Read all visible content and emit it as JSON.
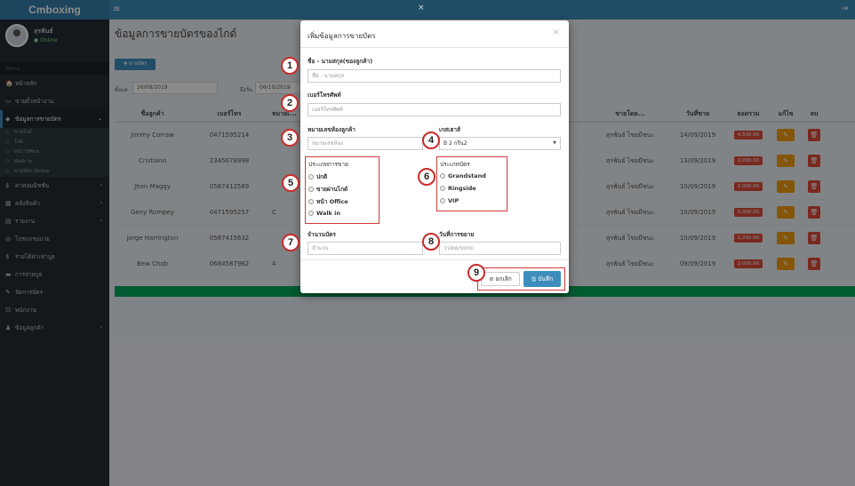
{
  "app": {
    "logo": "Cmboxing",
    "menu_icon": "≡",
    "signout_icon": "⇥"
  },
  "user": {
    "name": "สุรพันธ์",
    "status": "● Online"
  },
  "sidebar": {
    "header": "Menu",
    "items": [
      {
        "icon": "🏠",
        "label": "หน้าหลัก",
        "chev": ""
      },
      {
        "icon": "▭",
        "label": "ขายตั๋วหน้างาน",
        "chev": ""
      },
      {
        "icon": "◆",
        "label": "ข้อมูลการขายบัตร",
        "chev": "⌄"
      },
      {
        "icon": "$",
        "label": "ค่าคอมมิชชั่น",
        "chev": "‹"
      },
      {
        "icon": "▦",
        "label": "คลังสินค้า",
        "chev": "‹"
      },
      {
        "icon": "▤",
        "label": "รายงาน",
        "chev": "‹"
      },
      {
        "icon": "◎",
        "label": "โปรแกรมมวย",
        "chev": ""
      },
      {
        "icon": "$",
        "label": "รายได้ค่าเช่าบูธ",
        "chev": ""
      },
      {
        "icon": "▬",
        "label": "การจ่ายบูธ",
        "chev": ""
      },
      {
        "icon": "✎",
        "label": "จัดการบัตร",
        "chev": ""
      },
      {
        "icon": "☷",
        "label": "พนักงาน",
        "chev": ""
      },
      {
        "icon": "♟",
        "label": "ข้อมูลลูกค้า",
        "chev": "‹"
      }
    ],
    "submenu": [
      "ขายไกด์",
      "ไกด์",
      "หน้า Office",
      "Walk in",
      "ขายบัตร Online"
    ]
  },
  "page": {
    "title": "ข้อมูลการขายบัตรของไกด์",
    "add_button": "✚ ขายบัตร",
    "from_label": "ตั้งแต่",
    "from_value": "26/08/2019",
    "to_label": "ถึงวัน",
    "to_value": "06/10/2019"
  },
  "table": {
    "headers": {
      "name": "ชื่อลูกค้า",
      "phone": "เบอร์โทร",
      "room": "หมายเ...",
      "seller": "ขายโดย...",
      "date": "วันที่ขาย",
      "total": "ยอดรวม",
      "edit": "แก้ไข",
      "del": "ลบ"
    },
    "rows": [
      {
        "name": "Jimmy Corraw",
        "phone": "0471595214",
        "room": "",
        "seller": "สุรพันธ์ ไชยมีชนะ",
        "date": "14/09/2019",
        "total": "4,500.00"
      },
      {
        "name": "Cristiano",
        "phone": "2345678998",
        "room": "",
        "seller": "สุรพันธ์ ไชยมีชนะ",
        "date": "13/09/2019",
        "total": "2,000.00"
      },
      {
        "name": "Jhon Maggy",
        "phone": "0587412569",
        "room": "",
        "seller": "สุรพันธ์ ไชยมีชนะ",
        "date": "10/09/2019",
        "total": "2,000.00"
      },
      {
        "name": "Geny Rompey",
        "phone": "0471595257",
        "room": "C",
        "seller": "สุรพันธ์ ไชยมีชนะ",
        "date": "10/09/2019",
        "total": "5,000.00"
      },
      {
        "name": "Jorge Harrington",
        "phone": "0587415632",
        "room": "",
        "seller": "สุรพันธ์ ไชยมีชนะ",
        "date": "10/09/2019",
        "total": "1,200.00"
      },
      {
        "name": "Bew Chob",
        "phone": "0684587962",
        "room": "4",
        "seller": "สุรพันธ์ ไชยมีชนะ",
        "date": "09/09/2019",
        "total": "2,000.00"
      }
    ],
    "edit_icon": "✎",
    "del_icon": "🗑"
  },
  "overlay_close": "×",
  "modal": {
    "title": "เพิ่มข้อมูลการขายบัตร",
    "close": "×",
    "name_label": "ชื่อ - นามสกุล(ของลูกค้า)",
    "name_placeholder": "ชื่อ - นามสกุล",
    "phone_label": "เบอร์โทรศัพท์",
    "phone_placeholder": "เบอร์โทรศัพท์",
    "room_label": "หมายเลขห้องลูกค้า",
    "room_placeholder": "หมายเลขห้อง",
    "guide_label": "เกสเฮาส์",
    "guide_value": "B 2 กรีน2",
    "guide_caret": "▼",
    "sale_type_label": "ประเภทการขาย",
    "sale_types": [
      "ปกติ",
      "ขายผ่านไกด์",
      "หน้า Office",
      "Walk in"
    ],
    "seat_type_label": "ประเภทบัตร",
    "seat_types": [
      "Grandstand",
      "Ringside",
      "VIP"
    ],
    "qty_label": "จำนวนบัตร",
    "qty_placeholder": "จำนวน",
    "date_label": "วันที่การขยาย",
    "date_placeholder": "วว/ดด/ปปปป",
    "cancel_button": "⊘ ยกเลิก",
    "save_button": "🖫 บันทึก"
  },
  "annotations": [
    "1",
    "2",
    "3",
    "4",
    "5",
    "6",
    "7",
    "8",
    "9"
  ]
}
